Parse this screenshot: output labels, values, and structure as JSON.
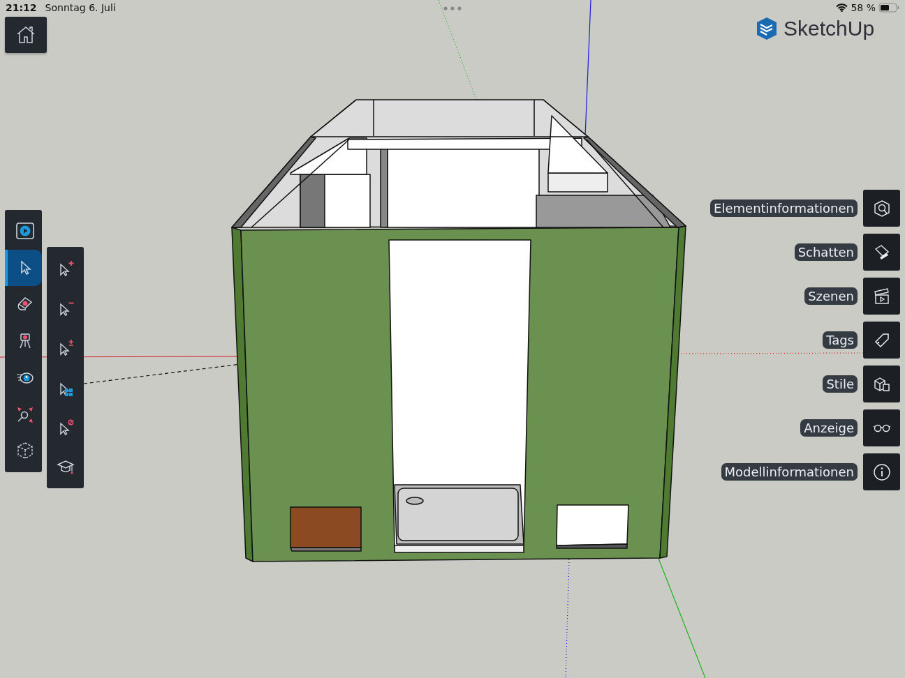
{
  "status_bar": {
    "time": "21:12",
    "date": "Sonntag 6. Juli",
    "battery": "58 %"
  },
  "logo": {
    "name": "SketchUp"
  },
  "left_toolbar": {
    "tools": [
      {
        "selected": false
      },
      {
        "selected": true
      },
      {
        "selected": false
      },
      {
        "selected": false
      },
      {
        "selected": false
      },
      {
        "selected": false
      },
      {
        "selected": false
      }
    ]
  },
  "select_toolbar": {
    "tools": [
      {
        "selected": false
      },
      {
        "selected": false
      },
      {
        "selected": false
      },
      {
        "selected": false
      },
      {
        "selected": false
      },
      {
        "selected": false
      }
    ]
  },
  "panels": [
    {
      "label": "Elementinformationen"
    },
    {
      "label": "Schatten"
    },
    {
      "label": "Szenen"
    },
    {
      "label": "Tags"
    },
    {
      "label": "Stile"
    },
    {
      "label": "Anzeige"
    },
    {
      "label": "Modellinformationen"
    }
  ]
}
